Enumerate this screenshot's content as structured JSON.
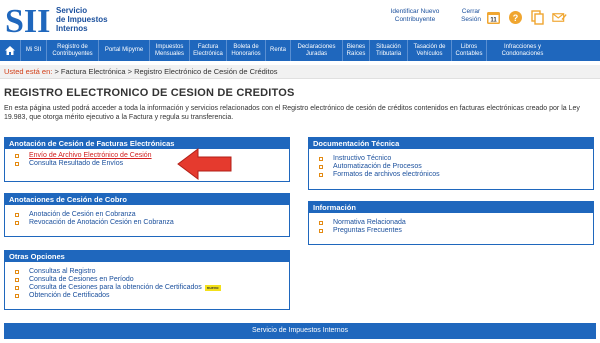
{
  "header": {
    "logo_text": "SII",
    "org_name": [
      "Servicio",
      "de Impuestos",
      "Internos"
    ],
    "links": [
      {
        "label": "Identificar Nuevo Contribuyente"
      },
      {
        "label": "Cerrar Sesión"
      }
    ],
    "icons": [
      "calendar-icon",
      "help-icon",
      "documents-icon",
      "mail-icon"
    ],
    "calendar_day": "11"
  },
  "nav": {
    "items": [
      "Mi SII",
      "Registro de Contribuyentes",
      "Portal Mipyme",
      "Impuestos Mensuales",
      "Factura Electrónica",
      "Boleta de Honorarios",
      "Renta",
      "Declaraciones Juradas",
      "Bienes Raíces",
      "Situación Tributaria",
      "Tasación de Vehículos",
      "Libros Contables",
      "Infracciones y Condonaciones"
    ]
  },
  "breadcrumb": {
    "here_label": "Usted está en:",
    "path": "> Factura Electrónica > Registro Electrónico de Cesión de Créditos"
  },
  "page": {
    "title": "REGISTRO ELECTRONICO DE CESION DE CREDITOS",
    "intro": "En esta página usted podrá acceder a toda la información y servicios relacionados con el Registro electrónico de cesión de créditos contenidos en facturas electrónicas creado por la Ley 19.983, que otorga mérito ejecutivo a la Factura y regula su transferencia."
  },
  "boxes": {
    "anotacion": {
      "title": "Anotación de Cesión de Facturas Electrónicas",
      "items": [
        "Envío de Archivo Electrónico de Cesión",
        "Consulta Resultado de Envíos"
      ]
    },
    "cobro": {
      "title": "Anotaciones de Cesión de Cobro",
      "items": [
        "Anotación de Cesión en Cobranza",
        "Revocación de Anotación Cesión en Cobranza"
      ]
    },
    "otras": {
      "title": "Otras Opciones",
      "items": [
        "Consultas al Registro",
        "Consulta de Cesiones en Período",
        "Consulta de Cesiones para la obtención de Certificados",
        "Obtención de Certificados"
      ],
      "badge": "nuevo"
    },
    "documentacion": {
      "title": "Documentación Técnica",
      "items": [
        "Instructivo Técnico",
        "Automatización de Procesos",
        "Formatos de archivos electrónicos"
      ]
    },
    "informacion": {
      "title": "Información",
      "items": [
        "Normativa Relacionada",
        "Preguntas Frecuentes"
      ]
    }
  },
  "footer": {
    "text": "Servicio de Impuestos Internos"
  },
  "colors": {
    "brand_blue": "#1f67bd",
    "link_blue": "#1a4f9c",
    "highlight_red": "#d12020",
    "bullet_orange": "#e38a12"
  }
}
